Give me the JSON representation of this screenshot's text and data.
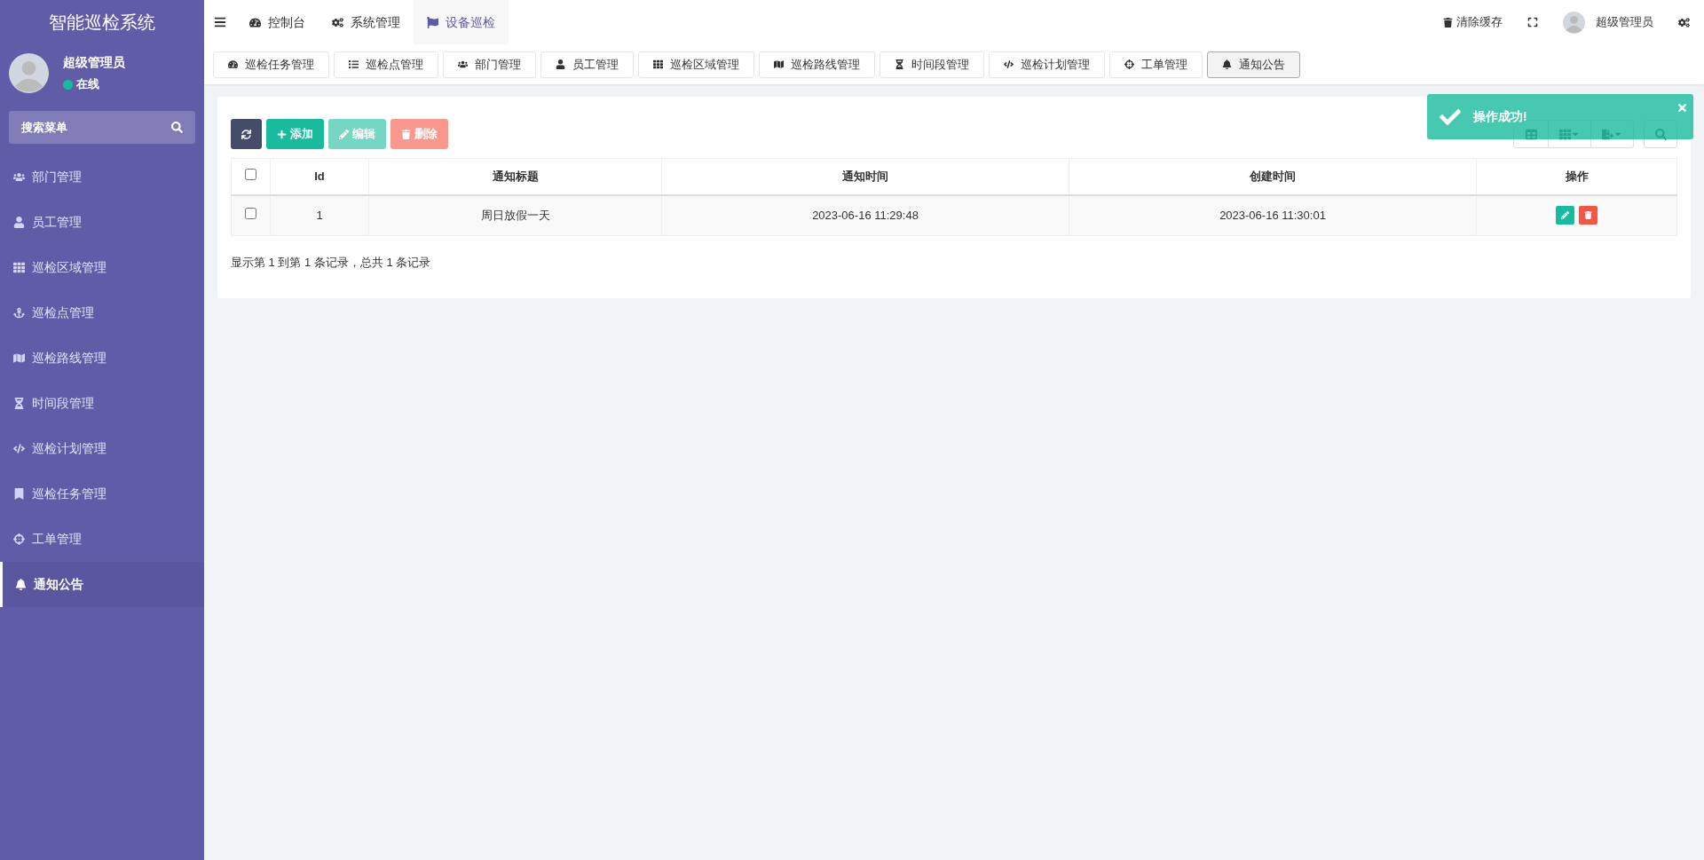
{
  "sidebar": {
    "title": "智能巡检系统",
    "user": {
      "name": "超级管理员",
      "status": "在线",
      "online": true
    },
    "search": {
      "placeholder": "搜索菜单"
    },
    "items": [
      {
        "label": "部门管理",
        "selected": false
      },
      {
        "label": "员工管理",
        "selected": false
      },
      {
        "label": "巡检区域管理",
        "selected": false
      },
      {
        "label": "巡检点管理",
        "selected": false
      },
      {
        "label": "巡检路线管理",
        "selected": false
      },
      {
        "label": "时间段管理",
        "selected": false
      },
      {
        "label": "巡检计划管理",
        "selected": false
      },
      {
        "label": "巡检任务管理",
        "selected": false
      },
      {
        "label": "工单管理",
        "selected": false
      },
      {
        "label": "通知公告",
        "selected": true
      }
    ]
  },
  "top_nav": [
    {
      "label": "控制台",
      "selected": false
    },
    {
      "label": "系统管理",
      "selected": false
    },
    {
      "label": "设备巡检",
      "selected": true
    }
  ],
  "header_right": {
    "clear_cache": "清除缓存",
    "user": "超级管理员"
  },
  "tabs": [
    {
      "label": "巡检任务管理",
      "selected": false
    },
    {
      "label": "巡检点管理",
      "selected": false
    },
    {
      "label": "部门管理",
      "selected": false
    },
    {
      "label": "员工管理",
      "selected": false
    },
    {
      "label": "巡检区域管理",
      "selected": false
    },
    {
      "label": "巡检路线管理",
      "selected": false
    },
    {
      "label": "时间段管理",
      "selected": false
    },
    {
      "label": "巡检计划管理",
      "selected": false
    },
    {
      "label": "工单管理",
      "selected": false
    },
    {
      "label": "通知公告",
      "selected": true
    }
  ],
  "toolbar": [
    {
      "kind": "refresh",
      "disabled": false
    },
    {
      "kind": "add",
      "label": "添加",
      "disabled": false
    },
    {
      "kind": "edit",
      "label": "编辑",
      "disabled": true
    },
    {
      "kind": "delete",
      "label": "删除",
      "disabled": true
    }
  ],
  "table": {
    "columns": [
      "Id",
      "通知标题",
      "通知时间",
      "创建时间",
      "操作"
    ],
    "rows": [
      {
        "checked": false,
        "cells": [
          "1",
          "周日放假一天",
          "2023-06-16 11:29:48",
          "2023-06-16 11:30:01"
        ]
      }
    ],
    "all_checked": false
  },
  "pagination_info": "显示第 1 到第 1 条记录，总共 1 条记录",
  "toast": {
    "message": "操作成功!"
  }
}
